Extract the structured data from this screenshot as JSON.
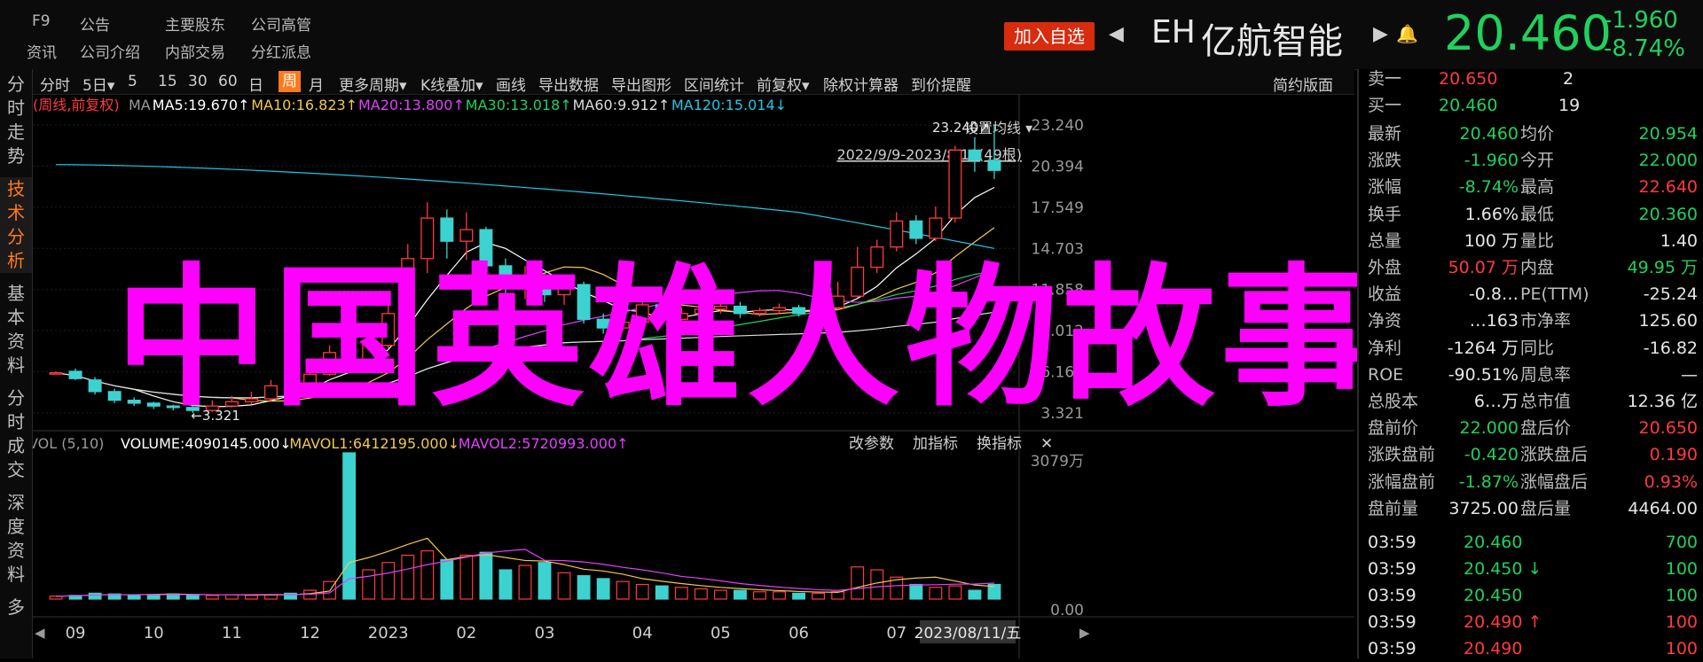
{
  "header": {
    "nav": [
      {
        "label": "F9",
        "x": 36,
        "y": 14
      },
      {
        "label": "公告",
        "x": 90,
        "y": 14
      },
      {
        "label": "主要股东",
        "x": 186,
        "y": 14
      },
      {
        "label": "公司高管",
        "x": 283,
        "y": 14
      },
      {
        "label": "资讯",
        "x": 30,
        "y": 45
      },
      {
        "label": "公司介绍",
        "x": 90,
        "y": 45
      },
      {
        "label": "内部交易",
        "x": 186,
        "y": 45
      },
      {
        "label": "分红派息",
        "x": 283,
        "y": 45
      }
    ],
    "add_button": "加入自选",
    "symbol": "EH",
    "name": "亿航智能",
    "price": "20.460",
    "change": "-1.960",
    "change_pct": "-8.74%"
  },
  "rail_tabs": [
    {
      "label": "分时走势",
      "active": false
    },
    {
      "label": "技术分析",
      "active": true
    },
    {
      "label": "基本资料",
      "active": false
    },
    {
      "label": "分时成交",
      "active": false
    },
    {
      "label": "深度资料",
      "active": false
    },
    {
      "label": "多",
      "active": false
    }
  ],
  "toolbar": {
    "items": [
      {
        "label": "分时"
      },
      {
        "label": "5日▾"
      },
      {
        "label": "5"
      },
      {
        "label": "15"
      },
      {
        "label": "30"
      },
      {
        "label": "60"
      },
      {
        "label": "日"
      },
      {
        "label": "周",
        "active": true
      },
      {
        "label": "月"
      },
      {
        "label": "更多周期▾"
      },
      {
        "label": "K线叠加▾"
      },
      {
        "label": "画线"
      },
      {
        "label": "导出数据"
      },
      {
        "label": "导出图形"
      },
      {
        "label": "区间统计"
      },
      {
        "label": "前复权▾"
      },
      {
        "label": "除权计算器"
      },
      {
        "label": "到价提醒"
      }
    ],
    "right_label": "简约版面"
  },
  "chart_data": {
    "type": "candlestick",
    "period_label": "(周线,前复权)",
    "ma_legend": [
      {
        "label": "MA",
        "color": "#9a9a9a"
      },
      {
        "label": "MA5:19.670↑",
        "color": "#ffffff"
      },
      {
        "label": "MA10:16.823↑",
        "color": "#f2c94c"
      },
      {
        "label": "MA20:13.800↑",
        "color": "#e040fb"
      },
      {
        "label": "MA30:13.018↑",
        "color": "#1fd15d"
      },
      {
        "label": "MA60:9.912↑",
        "color": "#dcdcdc"
      },
      {
        "label": "MA120:15.014↓",
        "color": "#1ec8e6"
      }
    ],
    "settings_label": "设置均线 ▾",
    "range_label": "2022/9/9-2023/8/11(49根)",
    "y_ticks": [
      "23.240",
      "20.394",
      "17.549",
      "14.703",
      "11.858",
      "9.012",
      "6.166",
      "3.321"
    ],
    "ylim": [
      3.321,
      23.24
    ],
    "max_label": "23.240↗",
    "min_label": "←3.321",
    "candles": [
      [
        6.1,
        6.1,
        6.2,
        6.0
      ],
      [
        6.2,
        5.7,
        6.4,
        5.6
      ],
      [
        5.6,
        4.8,
        5.8,
        4.6
      ],
      [
        4.8,
        4.2,
        5.0,
        4.0
      ],
      [
        4.2,
        4.0,
        4.4,
        3.8
      ],
      [
        4.0,
        3.8,
        4.1,
        3.6
      ],
      [
        3.8,
        3.7,
        3.9,
        3.5
      ],
      [
        3.7,
        3.5,
        3.8,
        3.32
      ],
      [
        3.5,
        3.8,
        4.2,
        3.4
      ],
      [
        3.8,
        4.1,
        4.5,
        3.7
      ],
      [
        4.1,
        4.3,
        4.8,
        3.9
      ],
      [
        4.3,
        5.2,
        5.6,
        4.1
      ],
      [
        5.2,
        5.1,
        5.8,
        4.8
      ],
      [
        5.1,
        6.0,
        6.5,
        5.0
      ],
      [
        6.0,
        7.5,
        8.0,
        5.9
      ],
      [
        7.5,
        6.8,
        11.5,
        6.6
      ],
      [
        6.8,
        8.0,
        8.5,
        6.5
      ],
      [
        8.0,
        10.2,
        10.8,
        7.8
      ],
      [
        10.2,
        14.0,
        15.0,
        9.8
      ],
      [
        14.0,
        16.8,
        17.9,
        13.0
      ],
      [
        16.8,
        15.2,
        17.4,
        14.0
      ],
      [
        15.2,
        16.0,
        17.2,
        13.9
      ],
      [
        16.0,
        13.5,
        16.2,
        12.8
      ],
      [
        13.5,
        12.0,
        14.0,
        11.5
      ],
      [
        12.0,
        12.8,
        13.5,
        11.2
      ],
      [
        12.8,
        11.5,
        13.0,
        11.0
      ],
      [
        11.5,
        12.2,
        12.5,
        10.8
      ],
      [
        12.2,
        9.8,
        12.4,
        9.5
      ],
      [
        9.8,
        9.2,
        10.2,
        8.8
      ],
      [
        9.2,
        9.6,
        10.5,
        9.0
      ],
      [
        9.6,
        10.8,
        11.2,
        9.4
      ],
      [
        10.8,
        9.8,
        11.0,
        9.6
      ],
      [
        9.8,
        10.2,
        10.6,
        9.7
      ],
      [
        10.2,
        10.5,
        10.8,
        10.0
      ],
      [
        10.5,
        10.7,
        11.0,
        10.2
      ],
      [
        10.7,
        10.2,
        11.0,
        9.9
      ],
      [
        10.2,
        10.4,
        10.6,
        10.0
      ],
      [
        10.4,
        10.6,
        10.9,
        10.2
      ],
      [
        10.6,
        10.2,
        10.8,
        10.0
      ],
      [
        10.2,
        10.6,
        11.0,
        10.1
      ],
      [
        10.6,
        11.4,
        12.4,
        10.4
      ],
      [
        11.4,
        13.4,
        14.8,
        11.3
      ],
      [
        13.4,
        14.8,
        15.3,
        13.0
      ],
      [
        14.8,
        16.6,
        17.2,
        14.5
      ],
      [
        16.6,
        15.4,
        17.0,
        15.0
      ],
      [
        15.4,
        16.8,
        17.6,
        15.2
      ],
      [
        16.8,
        21.5,
        21.8,
        16.5
      ],
      [
        21.5,
        20.8,
        22.4,
        20.0
      ],
      [
        20.8,
        20.1,
        23.24,
        19.5
      ]
    ],
    "volume_legend": [
      {
        "label": "VOL (5,10)",
        "color": "#9a9a9a"
      },
      {
        "label": "VOLUME:4090145.000↓",
        "color": "#ffffff"
      },
      {
        "label": "MAVOL1:6412195.000↓",
        "color": "#f2c94c"
      },
      {
        "label": "MAVOL2:5720993.000↑",
        "color": "#e040fb"
      }
    ],
    "vol_buttons": [
      "改参数",
      "加指标",
      "换指标",
      "✕"
    ],
    "vol_ticks": [
      "3079万",
      "0.00"
    ],
    "volumes": [
      20,
      25,
      40,
      35,
      30,
      30,
      35,
      30,
      25,
      30,
      25,
      30,
      40,
      60,
      120,
      1000,
      200,
      250,
      300,
      330,
      270,
      300,
      320,
      200,
      230,
      250,
      180,
      160,
      140,
      120,
      100,
      90,
      80,
      70,
      60,
      60,
      50,
      50,
      40,
      40,
      50,
      220,
      200,
      150,
      100,
      80,
      90,
      60,
      100
    ],
    "x_ticks": [
      {
        "label": "09",
        "i": 1
      },
      {
        "label": "10",
        "i": 5
      },
      {
        "label": "11",
        "i": 9
      },
      {
        "label": "12",
        "i": 13
      },
      {
        "label": "2023",
        "i": 17
      },
      {
        "label": "02",
        "i": 21
      },
      {
        "label": "03",
        "i": 25
      },
      {
        "label": "04",
        "i": 30
      },
      {
        "label": "05",
        "i": 34
      },
      {
        "label": "06",
        "i": 38
      },
      {
        "label": "07",
        "i": 43
      }
    ],
    "date_label": "2023/08/11/五"
  },
  "overlay_text": "中国英雄人物故事大全",
  "quote": {
    "ask": {
      "label": "卖一",
      "price": "20.650",
      "vol": "2"
    },
    "bid": {
      "label": "买一",
      "price": "20.460",
      "vol": "19"
    },
    "rows": [
      {
        "l1": "最新",
        "v1": "20.460",
        "c1": "green",
        "l2": "均价",
        "v2": "20.954",
        "c2": "green"
      },
      {
        "l1": "涨跌",
        "v1": "-1.960",
        "c1": "green",
        "l2": "今开",
        "v2": "22.000",
        "c2": "green"
      },
      {
        "l1": "涨幅",
        "v1": "-8.74%",
        "c1": "green",
        "l2": "最高",
        "v2": "22.640",
        "c2": "red"
      },
      {
        "l1": "换手",
        "v1": "1.66%",
        "c1": "white",
        "l2": "最低",
        "v2": "20.360",
        "c2": "green"
      },
      {
        "l1": "总量",
        "v1": "100 万",
        "c1": "white",
        "l2": "量比",
        "v2": "1.40",
        "c2": "white"
      },
      {
        "l1": "外盘",
        "v1": "50.07 万",
        "c1": "red",
        "l2": "内盘",
        "v2": "49.95 万",
        "c2": "green"
      },
      {
        "l1": "收益",
        "v1": "-0.8…",
        "c1": "white",
        "l2": "PE(TTM)",
        "v2": "-25.24",
        "c2": "white"
      },
      {
        "l1": "净资",
        "v1": "…163",
        "c1": "white",
        "l2": "市净率",
        "v2": "125.60",
        "c2": "white"
      },
      {
        "l1": "净利",
        "v1": "-1264 万",
        "c1": "white",
        "l2": "同比",
        "v2": "-16.82",
        "c2": "white"
      },
      {
        "l1": "ROE",
        "v1": "-90.51%",
        "c1": "white",
        "l2": "周息率",
        "v2": "—",
        "c2": "white"
      },
      {
        "l1": "总股本",
        "v1": "6…万",
        "c1": "white",
        "l2": "总市值",
        "v2": "12.36 亿",
        "c2": "white"
      },
      {
        "l1": "盘前价",
        "v1": "22.000",
        "c1": "green",
        "l2": "盘后价",
        "v2": "20.650",
        "c2": "red"
      },
      {
        "l1": "涨跌盘前",
        "v1": "-0.420",
        "c1": "green",
        "l2": "涨跌盘后",
        "v2": "0.190",
        "c2": "red"
      },
      {
        "l1": "涨幅盘前",
        "v1": "-1.87%",
        "c1": "green",
        "l2": "涨幅盘后",
        "v2": "0.93%",
        "c2": "red"
      },
      {
        "l1": "盘前量",
        "v1": "3725.00",
        "c1": "white",
        "l2": "盘后量",
        "v2": "4464.00",
        "c2": "white"
      }
    ],
    "ticks": [
      {
        "time": "03:59",
        "price": "20.460",
        "arrow": "",
        "vol": "700",
        "vc": "green"
      },
      {
        "time": "03:59",
        "price": "20.450",
        "arrow": "↓",
        "vol": "100",
        "vc": "green"
      },
      {
        "time": "03:59",
        "price": "20.450",
        "arrow": "",
        "vol": "100",
        "vc": "green"
      },
      {
        "time": "03:59",
        "price": "20.490",
        "arrow": "↑",
        "vol": "100",
        "vc": "red"
      },
      {
        "time": "03:59",
        "price": "20.490",
        "arrow": "",
        "vol": "100",
        "vc": "red"
      }
    ]
  }
}
